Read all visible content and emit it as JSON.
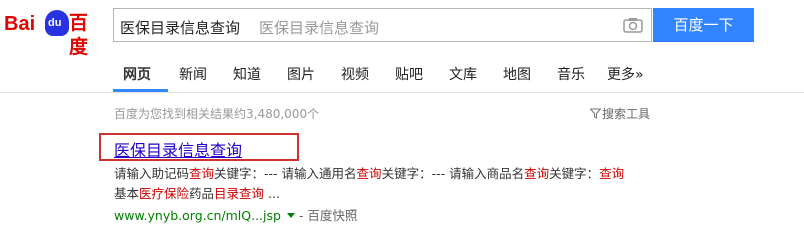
{
  "logo": {
    "bai": "Bai",
    "du": "du",
    "cn": "百度"
  },
  "search": {
    "value": "医保目录信息查询",
    "placeholder": "医保目录信息查询",
    "button": "百度一下"
  },
  "icons": {
    "camera": "camera-icon",
    "filter": "funnel-icon",
    "arrow": "chevron-down-icon"
  },
  "nav": {
    "items": [
      {
        "label": "网页",
        "active": true
      },
      {
        "label": "新闻"
      },
      {
        "label": "知道"
      },
      {
        "label": "图片"
      },
      {
        "label": "视频"
      },
      {
        "label": "贴吧"
      },
      {
        "label": "文库"
      },
      {
        "label": "地图"
      },
      {
        "label": "音乐"
      },
      {
        "label": "更多»"
      }
    ]
  },
  "results_info": {
    "count_text": "百度为您找到相关结果约3,480,000个",
    "tools_label": "搜索工具"
  },
  "result": {
    "title": "医保目录信息查询",
    "line1": [
      {
        "t": "请输入助记码",
        "em": false
      },
      {
        "t": "查询",
        "em": true
      },
      {
        "t": "关键字：--- 请输入通用名",
        "em": false
      },
      {
        "t": "查询",
        "em": true
      },
      {
        "t": "关键字：--- 请输入商品名",
        "em": false
      },
      {
        "t": "查询",
        "em": true
      },
      {
        "t": "关键字：",
        "em": false
      },
      {
        "t": "查询",
        "em": true
      }
    ],
    "line2": [
      {
        "t": "基本",
        "em": false
      },
      {
        "t": "医疗保险",
        "em": true
      },
      {
        "t": "药品",
        "em": false
      },
      {
        "t": "目录查询",
        "em": true
      },
      {
        "t": " ...",
        "em": false
      }
    ],
    "url": "www.ynyb.org.cn/mlQ...jsp",
    "snapshot": "- 百度快照"
  },
  "colors": {
    "brand_red": "#e10601",
    "brand_blue": "#2932e1",
    "button": "#3385ff",
    "link": "#2200cc",
    "highlight": "#d03131",
    "url": "#008000"
  }
}
